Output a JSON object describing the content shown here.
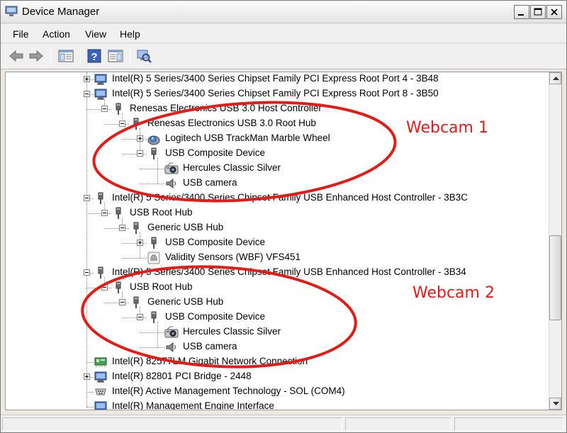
{
  "window": {
    "title": "Device Manager"
  },
  "menu": {
    "items": [
      "File",
      "Action",
      "View",
      "Help"
    ]
  },
  "toolbar": {
    "icons": [
      "back-arrow-icon",
      "forward-arrow-icon",
      "console-tree-icon",
      "help-icon",
      "action-pane-icon",
      "scan-hardware-icon"
    ]
  },
  "tree": {
    "rows": [
      {
        "label": "Intel(R) 5 Series/3400 Series Chipset Family PCI Express Root Port 4 - 3B48",
        "level": 0,
        "exp": "plus",
        "icon": "network-port-icon"
      },
      {
        "label": "Intel(R) 5 Series/3400 Series Chipset Family PCI Express Root Port 8 - 3B50",
        "level": 0,
        "exp": "minus",
        "icon": "network-port-icon"
      },
      {
        "label": "Renesas Electronics USB 3.0 Host Controller",
        "level": 1,
        "exp": "minus",
        "icon": "usb-plug-icon"
      },
      {
        "label": "Renesas Electronics USB 3.0 Root Hub",
        "level": 2,
        "exp": "minus",
        "icon": "usb-plug-icon"
      },
      {
        "label": "Logitech USB TrackMan Marble Wheel",
        "level": 3,
        "exp": "plus",
        "icon": "trackball-icon"
      },
      {
        "label": "USB Composite Device",
        "level": 3,
        "exp": "minus",
        "icon": "usb-plug-icon"
      },
      {
        "label": "Hercules Classic Silver",
        "level": 4,
        "exp": "none",
        "icon": "webcam-icon"
      },
      {
        "label": "USB camera",
        "level": 4,
        "exp": "none",
        "icon": "speaker-icon"
      },
      {
        "label": "Intel(R) 5 Series/3400 Series Chipset Family USB Enhanced Host Controller - 3B3C",
        "level": 0,
        "exp": "minus",
        "icon": "usb-plug-icon"
      },
      {
        "label": "USB Root Hub",
        "level": 1,
        "exp": "minus",
        "icon": "usb-plug-icon"
      },
      {
        "label": "Generic USB Hub",
        "level": 2,
        "exp": "minus",
        "icon": "usb-plug-icon"
      },
      {
        "label": "USB Composite Device",
        "level": 3,
        "exp": "plus",
        "icon": "usb-plug-icon"
      },
      {
        "label": "Validity Sensors (WBF) VFS451",
        "level": 3,
        "exp": "none",
        "icon": "fingerprint-icon"
      },
      {
        "label": "Intel(R) 5 Series/3400 Series Chipset Family USB Enhanced Host Controller - 3B34",
        "level": 0,
        "exp": "minus",
        "icon": "usb-plug-icon"
      },
      {
        "label": "USB Root Hub",
        "level": 1,
        "exp": "minus",
        "icon": "usb-plug-icon"
      },
      {
        "label": "Generic USB Hub",
        "level": 2,
        "exp": "minus",
        "icon": "usb-plug-icon"
      },
      {
        "label": "USB Composite Device",
        "level": 3,
        "exp": "minus",
        "icon": "usb-plug-icon"
      },
      {
        "label": "Hercules Classic Silver",
        "level": 4,
        "exp": "none",
        "icon": "webcam-icon"
      },
      {
        "label": "USB camera",
        "level": 4,
        "exp": "none",
        "icon": "speaker-icon"
      },
      {
        "label": "Intel(R) 82577LM Gigabit Network Connection",
        "level": 0,
        "exp": "none",
        "icon": "network-adapter-icon"
      },
      {
        "label": "Intel(R) 82801 PCI Bridge - 2448",
        "level": 0,
        "exp": "plus",
        "icon": "network-port-icon"
      },
      {
        "label": "Intel(R) Active Management Technology - SOL (COM4)",
        "level": 0,
        "exp": "none",
        "icon": "serial-port-icon"
      },
      {
        "label": "Intel(R) Management Engine Interface",
        "level": 0,
        "exp": "none",
        "icon": "network-port-icon"
      }
    ]
  },
  "annotations": {
    "webcam1": "Webcam 1",
    "webcam2": "Webcam 2",
    "color": "#e41b17"
  }
}
